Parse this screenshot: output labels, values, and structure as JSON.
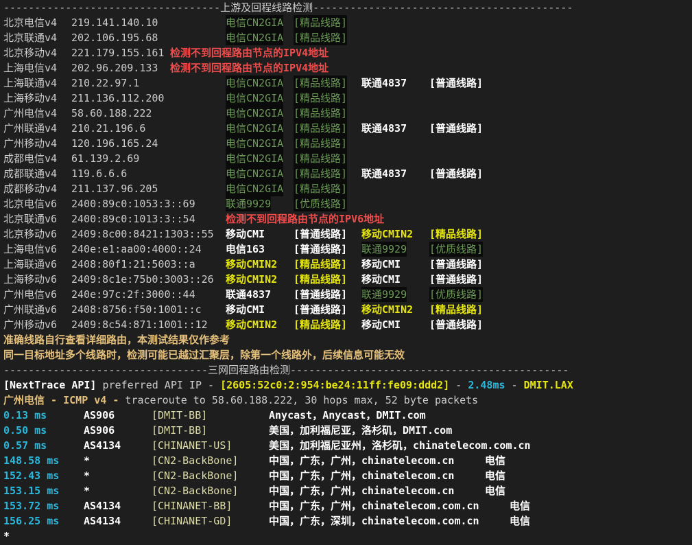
{
  "section1_title": "上游及回程线路检测",
  "section1": [
    {
      "label": "北京电信v4",
      "ip": "219.141.140.10",
      "route1": "电信CN2GIA",
      "tag1": "[精品线路]"
    },
    {
      "label": "北京联通v4",
      "ip": "202.106.195.68",
      "route1": "电信CN2GIA",
      "tag1": "[精品线路]"
    },
    {
      "label": "北京移动v4",
      "ip": "221.179.155.161",
      "error": "检测不到回程路由节点的IPV4地址"
    },
    {
      "label": "上海电信v4",
      "ip": "202.96.209.133",
      "error": "检测不到回程路由节点的IPV4地址"
    },
    {
      "label": "上海联通v4",
      "ip": "210.22.97.1",
      "route1": "电信CN2GIA",
      "tag1": "[精品线路]",
      "route2": "联通4837",
      "tag2": "[普通线路]"
    },
    {
      "label": "上海移动v4",
      "ip": "211.136.112.200",
      "route1": "电信CN2GIA",
      "tag1": "[精品线路]"
    },
    {
      "label": "广州电信v4",
      "ip": "58.60.188.222",
      "route1": "电信CN2GIA",
      "tag1": "[精品线路]"
    },
    {
      "label": "广州联通v4",
      "ip": "210.21.196.6",
      "route1": "电信CN2GIA",
      "tag1": "[精品线路]",
      "route2": "联通4837",
      "tag2": "[普通线路]"
    },
    {
      "label": "广州移动v4",
      "ip": "120.196.165.24",
      "route1": "电信CN2GIA",
      "tag1": "[精品线路]"
    },
    {
      "label": "成都电信v4",
      "ip": "61.139.2.69",
      "route1": "电信CN2GIA",
      "tag1": "[精品线路]"
    },
    {
      "label": "成都联通v4",
      "ip": "119.6.6.6",
      "route1": "电信CN2GIA",
      "tag1": "[精品线路]",
      "route2": "联通4837",
      "tag2": "[普通线路]"
    },
    {
      "label": "成都移动v4",
      "ip": "211.137.96.205",
      "route1": "电信CN2GIA",
      "tag1": "[精品线路]"
    },
    {
      "label": "北京电信v6",
      "ip": "2400:89c0:1053:3::69",
      "route1": "联通9929",
      "tag1": "[优质线路]"
    },
    {
      "label": "北京联通v6",
      "ip": "2400:89c0:1013:3::54",
      "error": "检测不到回程路由节点的IPV6地址"
    },
    {
      "label": "北京移动v6",
      "ip": "2409:8c00:8421:1303::55",
      "route1": "移动CMI",
      "tag1": "[普通线路]",
      "route2": "移动CMIN2",
      "tag2": "[精品线路]"
    },
    {
      "label": "上海电信v6",
      "ip": "240e:e1:aa00:4000::24",
      "route1": "电信163",
      "tag1": "[普通线路]",
      "route2": "联通9929",
      "tag2": "[优质线路]"
    },
    {
      "label": "上海联通v6",
      "ip": "2408:80f1:21:5003::a",
      "route1": "移动CMIN2",
      "tag1": "[精品线路]",
      "route2": "移动CMI",
      "tag2": "[普通线路]"
    },
    {
      "label": "上海移动v6",
      "ip": "2409:8c1e:75b0:3003::26",
      "route1": "移动CMIN2",
      "tag1": "[精品线路]",
      "route2": "移动CMI",
      "tag2": "[普通线路]"
    },
    {
      "label": "广州电信v6",
      "ip": "240e:97c:2f:3000::44",
      "route1": "联通4837",
      "tag1": "[普通线路]",
      "route2": "联通9929",
      "tag2": "[优质线路]"
    },
    {
      "label": "广州联通v6",
      "ip": "2408:8756:f50:1001::c",
      "route1": "移动CMI",
      "tag1": "[普通线路]",
      "route2": "移动CMIN2",
      "tag2": "[精品线路]"
    },
    {
      "label": "广州移动v6",
      "ip": "2409:8c54:871:1001::12",
      "route1": "移动CMIN2",
      "tag1": "[精品线路]",
      "route2": "移动CMI",
      "tag2": "[普通线路]"
    }
  ],
  "notes": [
    "准确线路自行查看详细路由，本测试结果仅作参考",
    "同一目标地址多个线路时，检测可能已越过汇聚层，除第一个线路外，后续信息可能无效"
  ],
  "section2_title": "三网回程路由检测",
  "api": {
    "name": "[NextTrace API]",
    "pref": " preferred API IP - ",
    "ip": "[2605:52c0:2:954:be24:11ff:fe09:ddd2]",
    "dash1": " - ",
    "latency": "2.48ms",
    "dash2": " - ",
    "host": "DMIT.LAX"
  },
  "trace_header": {
    "target": "广州电信",
    "proto": " - ICMP v4 - ",
    "rest": "traceroute to 58.60.188.222, 30 hops max, 52 byte packets"
  },
  "hops": [
    {
      "ms": "0.13 ms",
      "asn": "AS906",
      "net": "[DMIT-BB]",
      "geo": "Anycast，Anycast，DMIT.com",
      "isp": ""
    },
    {
      "ms": "0.50 ms",
      "asn": "AS906",
      "net": "[DMIT-BB]",
      "geo": "美国，加利福尼亚，洛杉矶，DMIT.com",
      "isp": ""
    },
    {
      "ms": "0.57 ms",
      "asn": "AS4134",
      "net": "[CHINANET-US]",
      "geo": "美国，加利福尼亚州，洛杉矶，chinatelecom.com.cn",
      "isp": ""
    },
    {
      "ms": "148.58 ms",
      "asn": "*",
      "net": "[CN2-BackBone]",
      "geo": "中国，广东，广州，chinatelecom.cn",
      "isp": "电信"
    },
    {
      "ms": "152.43 ms",
      "asn": "*",
      "net": "[CN2-BackBone]",
      "geo": "中国，广东，广州，chinatelecom.cn",
      "isp": "电信"
    },
    {
      "ms": "153.15 ms",
      "asn": "*",
      "net": "[CN2-BackBone]",
      "geo": "中国，广东，广州，chinatelecom.cn",
      "isp": "电信"
    },
    {
      "ms": "153.72 ms",
      "asn": "AS4134",
      "net": "[CHINANET-BB]",
      "geo": "中国，广东，广州，chinatelecom.com.cn",
      "isp": "电信"
    },
    {
      "ms": "156.25 ms",
      "asn": "AS4134",
      "net": "[CHINANET-GD]",
      "geo": "中国，广东，深圳，chinatelecom.com.cn",
      "isp": "电信"
    }
  ],
  "last_line": "*",
  "colors": {
    "good": "#6a9955",
    "plain": "#ffffff",
    "cmin2": "#e5e510",
    "error": "#f14c4c",
    "latency": "#29b8db"
  }
}
